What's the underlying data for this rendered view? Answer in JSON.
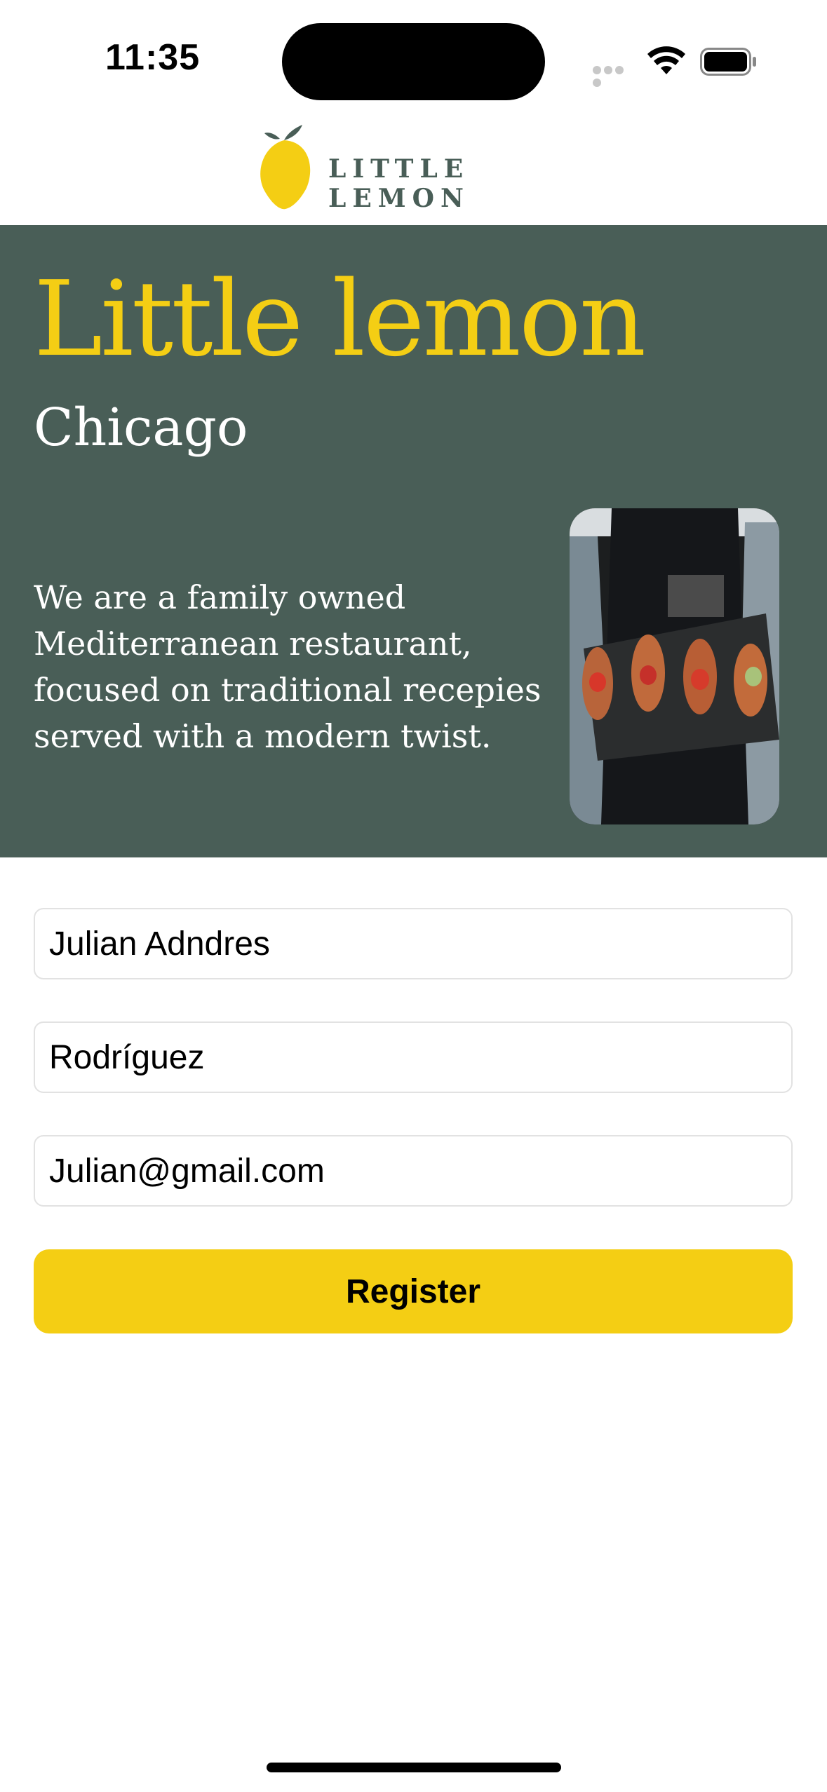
{
  "status_bar": {
    "time": "11:35",
    "icons": [
      "cellular-icon",
      "wifi-icon",
      "battery-icon"
    ]
  },
  "header": {
    "logo_text": "LITTLE LEMON",
    "logo_icon": "lemon-icon"
  },
  "hero": {
    "title": "Little lemon",
    "subtitle": "Chicago",
    "description": "We are a family owned Mediterranean restaurant, focused on traditional recepies served with a modern twist.",
    "image": "hero-food-image"
  },
  "form": {
    "first_name": "Julian Adndres",
    "last_name": "Rodríguez",
    "email": "Julian@gmail.com",
    "register_label": "Register"
  },
  "colors": {
    "brand_green": "#495e57",
    "brand_yellow": "#f4ce14",
    "background": "#ffffff"
  }
}
